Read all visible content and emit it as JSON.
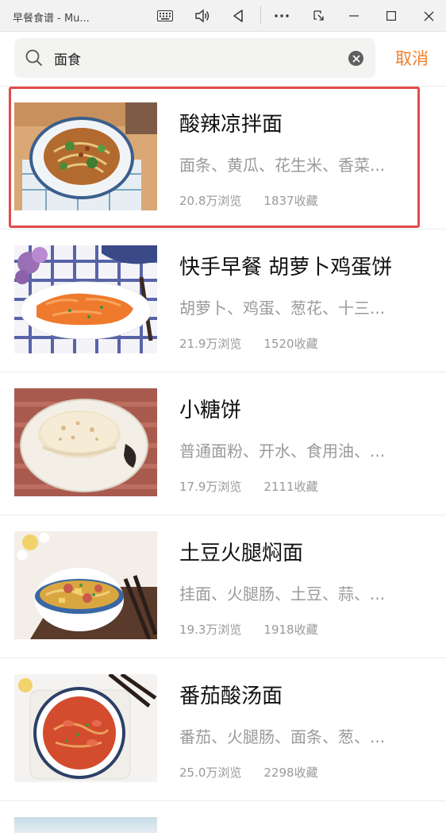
{
  "window": {
    "title": "早餐食谱 - Mu...",
    "buttons": [
      "keyboard-icon",
      "speaker-icon",
      "back-triangle-icon",
      "more-icon",
      "snap-icon",
      "minimize-icon",
      "maximize-icon",
      "close-icon"
    ]
  },
  "search": {
    "query": "面食",
    "cancel_label": "取消",
    "accent_color": "#f07f2b"
  },
  "recipes": [
    {
      "title": "酸辣凉拌面",
      "ingredients": "面条、黄瓜、花生米、香菜...",
      "views": "20.8万浏览",
      "favorites": "1837收藏",
      "highlighted": true
    },
    {
      "title": "快手早餐 胡萝卜鸡蛋饼",
      "ingredients": "胡萝卜、鸡蛋、葱花、十三...",
      "views": "21.9万浏览",
      "favorites": "1520收藏"
    },
    {
      "title": "小糖饼",
      "ingredients": "普通面粉、开水、食用油、...",
      "views": "17.9万浏览",
      "favorites": "2111收藏"
    },
    {
      "title": "土豆火腿焖面",
      "ingredients": "挂面、火腿肠、土豆、蒜、...",
      "views": "19.3万浏览",
      "favorites": "1918收藏"
    },
    {
      "title": "番茄酸汤面",
      "ingredients": "番茄、火腿肠、面条、葱、...",
      "views": "25.0万浏览",
      "favorites": "2298收藏"
    }
  ],
  "highlight_color": "#e24b4b"
}
